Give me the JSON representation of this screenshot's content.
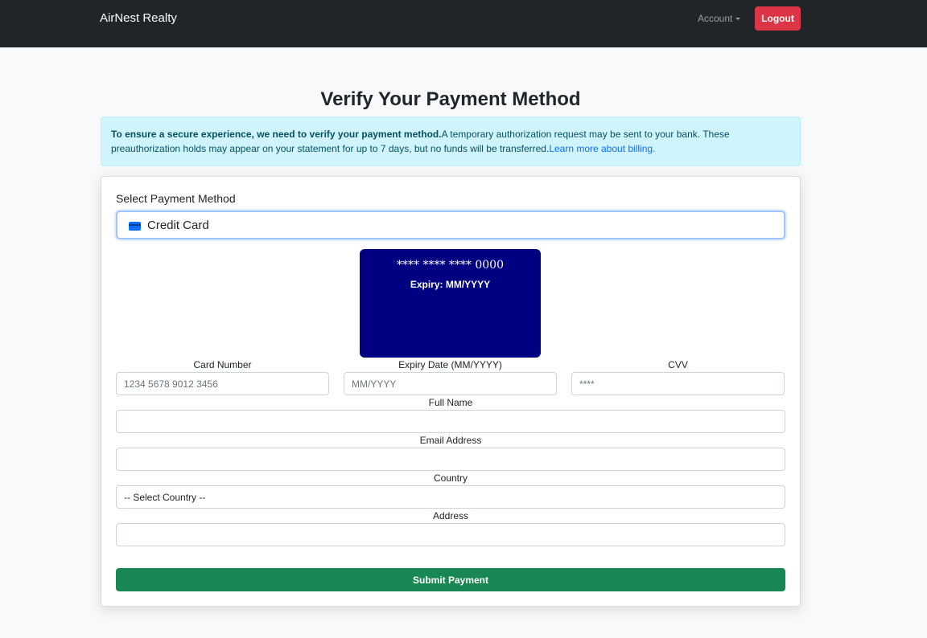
{
  "nav": {
    "brand": "AirNest Realty",
    "account_label": "Account",
    "logout_label": "Logout"
  },
  "page": {
    "title": "Verify Your Payment Method"
  },
  "alert": {
    "bold_text": "To ensure a secure experience, we need to verify your payment method.",
    "body_text": "A temporary authorization request may be sent to your bank. These preauthorization holds may appear on your statement for up to 7 days, but no funds will be transferred.",
    "link_text": "Learn more about billing."
  },
  "payment_method": {
    "label": "Select Payment Method",
    "selected": "Credit Card",
    "icon": "credit-card-icon"
  },
  "card_preview": {
    "number": "**** **** **** 0000",
    "expiry": "Expiry: MM/YYYY",
    "color": "#000080"
  },
  "form": {
    "card_number": {
      "label": "Card Number",
      "placeholder": "1234 5678 9012 3456"
    },
    "expiry": {
      "label": "Expiry Date (MM/YYYY)",
      "placeholder": "MM/YYYY"
    },
    "cvv": {
      "label": "CVV",
      "placeholder": "****"
    },
    "full_name": {
      "label": "Full Name",
      "value": ""
    },
    "email": {
      "label": "Email Address",
      "value": ""
    },
    "country": {
      "label": "Country",
      "selected": "-- Select Country --"
    },
    "address": {
      "label": "Address",
      "value": ""
    }
  },
  "submit_label": "Submit Payment",
  "colors": {
    "navbar": "#212529",
    "logout": "#dc3545",
    "alert_bg": "#cff4fc",
    "submit": "#198754",
    "link": "#0d6efd"
  }
}
